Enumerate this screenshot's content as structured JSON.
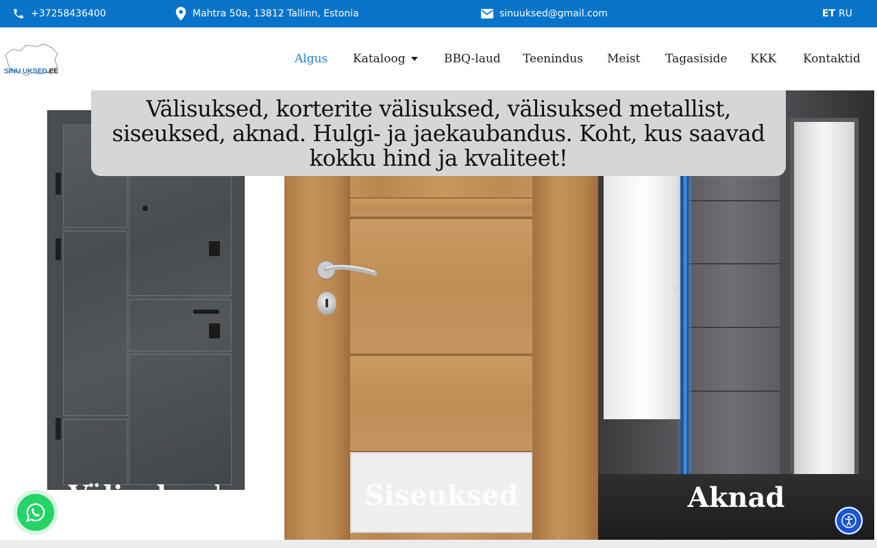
{
  "topbar": {
    "phone": "+37258436400",
    "address": "Mahtra 50a, 13812 Tallinn, Estonia",
    "email": "sinuuksed@gmail.com",
    "languages": [
      {
        "code": "ET",
        "active": true
      },
      {
        "code": "RU",
        "active": false
      }
    ],
    "background_color": "#0874c9"
  },
  "logo": {
    "part1": "SINU UKSED",
    "part2": ".EE"
  },
  "nav": {
    "items": [
      {
        "label": "Algus",
        "active": true
      },
      {
        "label": "Kataloog",
        "has_dropdown": true
      },
      {
        "label": "BBQ-laud"
      },
      {
        "label": "Teenindus"
      },
      {
        "label": "Meist"
      },
      {
        "label": "Tagasiside"
      },
      {
        "label": "KKK"
      },
      {
        "label": "Kontaktid"
      }
    ],
    "active_color": "#1e7fd6"
  },
  "hero": {
    "headline": "Välisuksed, korterite välisuksed, välisuksed metallist, siseuksed, aknad. Hulgi- ja jaekaubandus. Koht, kus saavad kokku hind ja kvaliteet!",
    "categories": [
      {
        "label": "Välisuksed"
      },
      {
        "label": "Siseuksed"
      },
      {
        "label": "Aknad"
      }
    ]
  },
  "widgets": {
    "whatsapp_icon": "whatsapp-icon",
    "accessibility_icon": "accessibility-icon"
  }
}
